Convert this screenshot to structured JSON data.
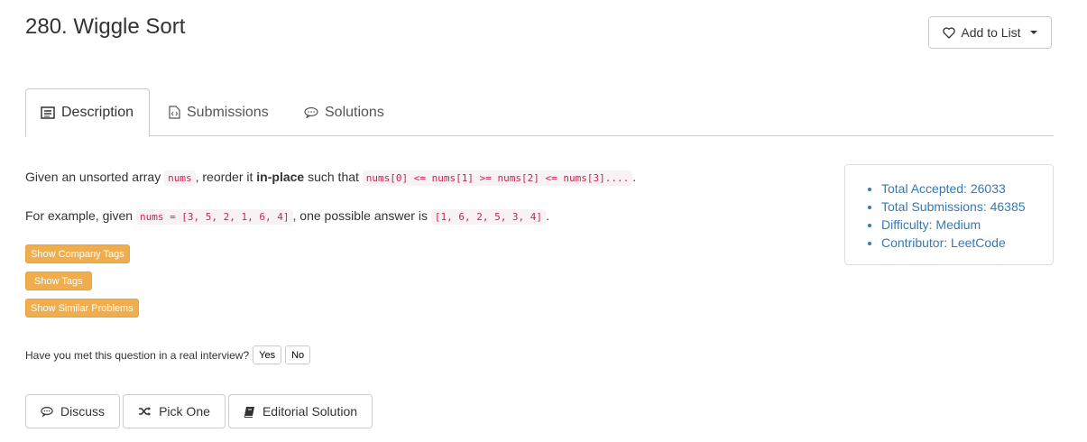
{
  "problem": {
    "title": "280. Wiggle Sort"
  },
  "actions": {
    "add_to_list": "Add to List"
  },
  "tabs": [
    {
      "label": "Description",
      "icon": "description-icon"
    },
    {
      "label": "Submissions",
      "icon": "code-file-icon"
    },
    {
      "label": "Solutions",
      "icon": "chat-bubble-icon"
    }
  ],
  "description": {
    "line1_a": "Given an unsorted array ",
    "line1_code1": "nums",
    "line1_b": ", reorder it ",
    "line1_bold": "in-place",
    "line1_c": " such that ",
    "line1_code2": "nums[0] <= nums[1] >= nums[2] <= nums[3]....",
    "line1_d": ".",
    "line2_a": "For example, given ",
    "line2_code1": "nums = [3, 5, 2, 1, 6, 4]",
    "line2_b": ", one possible answer is ",
    "line2_code2": "[1, 6, 2, 5, 3, 4]",
    "line2_c": "."
  },
  "tag_buttons": {
    "company": "Show Company Tags",
    "tags": "Show Tags",
    "similar": "Show Similar Problems"
  },
  "interview": {
    "question": "Have you met this question in a real interview?",
    "yes": "Yes",
    "no": "No"
  },
  "bottom_buttons": {
    "discuss": "Discuss",
    "pick_one": "Pick One",
    "editorial": "Editorial Solution"
  },
  "stats": {
    "accepted": "Total Accepted: 26033",
    "submissions": "Total Submissions: 46385",
    "difficulty": "Difficulty: Medium",
    "contributor": "Contributor: LeetCode"
  },
  "colors": {
    "link": "#337ab7",
    "warning": "#f0ad4e",
    "code_text": "#c7254e",
    "code_bg": "#f9f2f4"
  }
}
